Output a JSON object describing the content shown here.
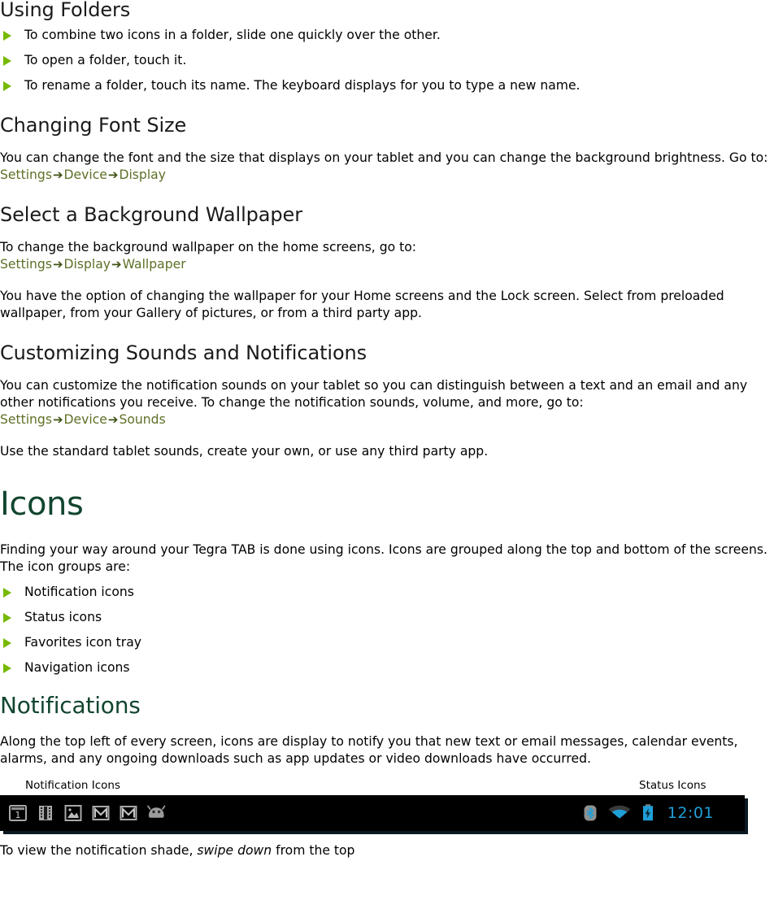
{
  "colors": {
    "bullet_green": "#76b900",
    "path_green": "#5d7027",
    "heading_green": "#12452f",
    "status_blue": "#1f9fd8",
    "statusbar_bg": "#000000",
    "icon_gray": "#9a9a9a"
  },
  "sections": {
    "using_folders": {
      "heading": "Using Folders",
      "bullets": [
        "To combine two icons in a folder, slide one quickly over the other.",
        "To open a folder, touch it.",
        "To rename a folder, touch its name. The keyboard displays for you to type a new name."
      ]
    },
    "changing_font_size": {
      "heading": "Changing Font Size",
      "paragraph": "You can change the font and the size that displays on your tablet and you can change the background brightness. Go to:",
      "path": [
        "Settings",
        "Device",
        "Display"
      ]
    },
    "select_wallpaper": {
      "heading": "Select a Background Wallpaper",
      "paragraph": "To change the background wallpaper on the home screens, go to:",
      "path": [
        "Settings",
        "Display",
        "Wallpaper"
      ],
      "paragraph2": "You have the option of changing the wallpaper for your Home screens and the Lock screen. Select from preloaded wallpaper, from your Gallery of pictures, or from a third party app."
    },
    "customizing_sounds": {
      "heading": "Customizing Sounds and Notifications",
      "paragraph": "You can customize the notification sounds on your tablet so you can distinguish between a text and an email and any other notifications you receive. To change the notification sounds, volume, and more, go to:",
      "path": [
        "Settings",
        "Device",
        "Sounds"
      ],
      "paragraph2": "Use the standard tablet sounds, create your own, or use any third party app."
    },
    "icons": {
      "heading": "Icons",
      "paragraph": "Finding your way around your Tegra TAB is done using icons. Icons are grouped along the top and bottom of the screens. The icon groups are:",
      "bullets": [
        "Notification icons",
        "Status icons",
        "Favorites icon tray",
        "Navigation icons"
      ]
    },
    "notifications": {
      "heading": "Notifications",
      "paragraph": "Along the top left of every screen, icons are display to notify you that new text or email messages, calendar events, alarms, and any ongoing downloads such as app updates or video downloads have occurred.",
      "figure": {
        "label_left": "Notification Icons",
        "label_right": "Status Icons",
        "notification_icons": [
          "calendar-icon",
          "film-strip-icon",
          "photo-gallery-icon",
          "gmail-icon",
          "gmail-icon",
          "android-head-icon"
        ],
        "calendar_day": "1",
        "status_icons": [
          "bluetooth-icon",
          "wifi-icon",
          "battery-charging-icon"
        ],
        "time": "12:01"
      },
      "closing_prefix": "To view the notification shade, ",
      "closing_italic": "swipe down",
      "closing_suffix": " from the top"
    }
  },
  "arrow_glyph": "➔"
}
